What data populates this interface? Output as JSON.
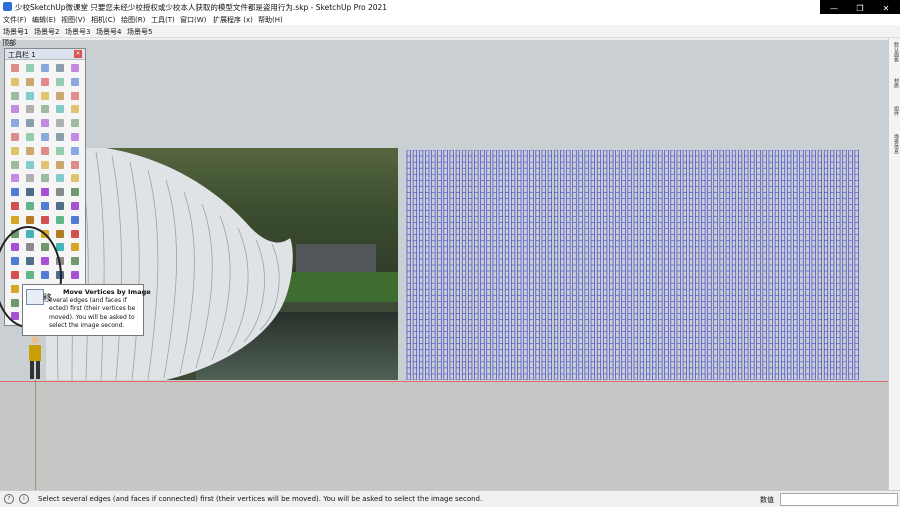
{
  "window": {
    "title": "少校SketchUp微课堂 只要您未经少校授权或少校本人获取的模型文件都是盗用行为.skp - SketchUp Pro 2021",
    "controls": [
      "—",
      "❐",
      "✕"
    ]
  },
  "menu": [
    "文件(F)",
    "编辑(E)",
    "视图(V)",
    "相机(C)",
    "绘图(R)",
    "工具(T)",
    "窗口(W)",
    "扩展程序 (x)",
    "帮助(H)"
  ],
  "scenes": [
    "场景号1",
    "场景号2",
    "场景号3",
    "场景号4",
    "场景号5"
  ],
  "viewport": {
    "label": "顶部"
  },
  "right_panel": {
    "tabs": [
      "默认面板",
      "材质",
      "组件",
      "场景信息"
    ]
  },
  "toolbar": {
    "title": "工具栏 1",
    "close": "×"
  },
  "tooltip": {
    "title": "Move Vertices by Image",
    "zh": "移",
    "body": "everal edges (and faces if ected) first (their vertices be moved). You will be asked to select the image second."
  },
  "status": {
    "text": "Select several edges (and faces if connected) first (their vertices will be moved). You will be asked to select the image second.",
    "measure_label": "数值",
    "measure_value": ""
  },
  "colors": {
    "grid_blue": "#2d2fc8",
    "horizon_red": "#e06b6b",
    "axis_green": "#7fa07f"
  }
}
